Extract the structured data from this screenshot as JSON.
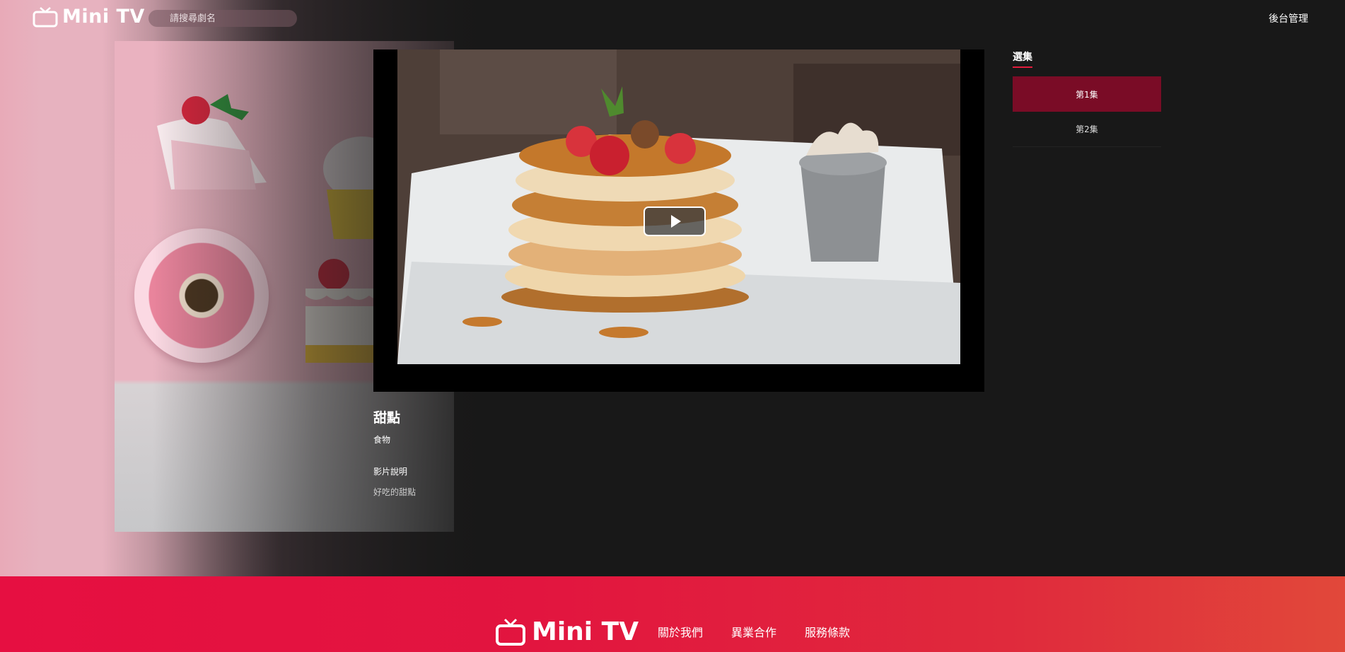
{
  "header": {
    "logo_text": "Mini TV",
    "search_placeholder": "請搜尋劇名",
    "admin_label": "後台管理"
  },
  "video": {
    "title": "甜點",
    "category": "食物",
    "description_heading": "影片說明",
    "description": "好吃的甜點"
  },
  "episodes": {
    "heading": "選集",
    "items": [
      {
        "label": "第1集",
        "active": true
      },
      {
        "label": "第2集",
        "active": false
      }
    ]
  },
  "footer": {
    "logo_text": "Mini TV",
    "links": [
      "關於我們",
      "異業合作",
      "服務條款"
    ]
  },
  "colors": {
    "accent": "#e21b3c",
    "active_episode": "#7a0c26",
    "background": "#181818",
    "footer_start": "#e60f41",
    "footer_end": "#e1483a"
  }
}
